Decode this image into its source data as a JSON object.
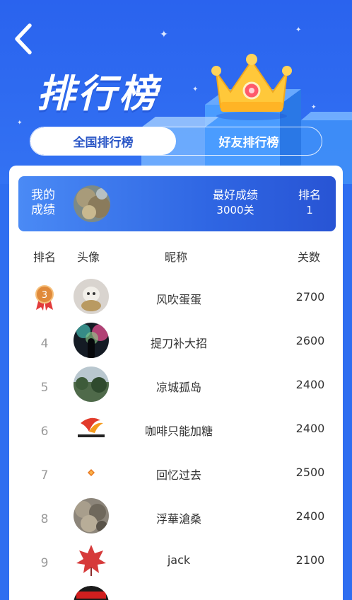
{
  "header": {
    "title": "排行榜",
    "back_icon": "chevron-left-icon"
  },
  "tabs": [
    {
      "label": "全国排行榜",
      "active": true
    },
    {
      "label": "好友排行榜",
      "active": false
    }
  ],
  "my_score": {
    "label": "我的成绩",
    "best_label": "最好成绩",
    "best_value": "3000关",
    "rank_label": "排名",
    "rank_value": "1"
  },
  "table": {
    "headers": {
      "rank": "排名",
      "avatar": "头像",
      "name": "昵称",
      "score": "关数"
    },
    "rows": [
      {
        "rank": "3",
        "medal": "bronze",
        "name": "风吹蛋蛋",
        "score": "2700"
      },
      {
        "rank": "4",
        "name": "提刀补大招",
        "score": "2600"
      },
      {
        "rank": "5",
        "name": "凉城孤岛",
        "score": "2400"
      },
      {
        "rank": "6",
        "name": "咖啡只能加糖",
        "score": "2400"
      },
      {
        "rank": "7",
        "name": "回忆过去",
        "score": "2500"
      },
      {
        "rank": "8",
        "name": "浮華滄桑",
        "score": "2400"
      },
      {
        "rank": "9",
        "name": "jack",
        "score": "2100"
      }
    ]
  },
  "colors": {
    "background": "#2f6ef0",
    "accent": "#2a56c6",
    "tab_active_text": "#2a56c6"
  }
}
